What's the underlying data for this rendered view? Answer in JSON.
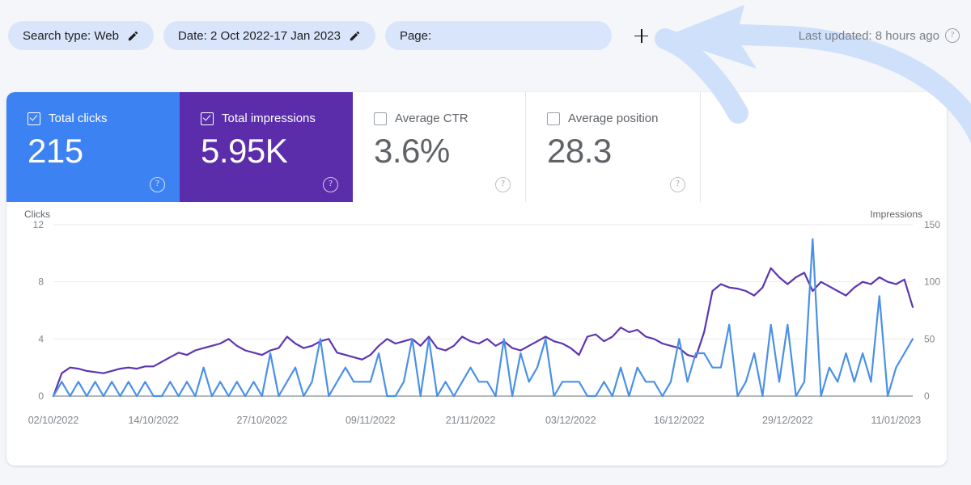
{
  "filters": {
    "search_type": {
      "label": "Search type: Web",
      "icon": "pencil-icon"
    },
    "date": {
      "label": "Date: 2 Oct 2022-17 Jan 2023",
      "icon": "pencil-icon"
    },
    "page": {
      "label": "Page:",
      "placeholder": ""
    },
    "add_filter": {
      "icon": "plus-icon"
    }
  },
  "status": {
    "last_updated": "Last updated: 8 hours ago",
    "help_icon": "question-circle-icon"
  },
  "metrics": [
    {
      "name": "Total clicks",
      "value": "215",
      "checked": true,
      "color": "#3d82f2",
      "help": "?"
    },
    {
      "name": "Total impressions",
      "value": "5.95K",
      "checked": true,
      "color": "#5b2dab",
      "help": "?"
    },
    {
      "name": "Average CTR",
      "value": "3.6%",
      "checked": false,
      "color": "#ffffff",
      "help": "?"
    },
    {
      "name": "Average position",
      "value": "28.3",
      "checked": false,
      "color": "#ffffff",
      "help": "?"
    }
  ],
  "annotation": {
    "type": "hand-drawn-arrow",
    "color": "#cfe0fb",
    "points_to": "add-filter-button"
  },
  "chart_data": {
    "type": "line",
    "title": "",
    "xlabel": "",
    "ylabel": "Clicks",
    "y2label": "Impressions",
    "ylim": [
      0,
      12
    ],
    "y2lim": [
      0,
      150
    ],
    "yticks": [
      0,
      4,
      8,
      12
    ],
    "y2ticks": [
      0,
      50,
      100,
      150
    ],
    "grid": true,
    "legend": "none",
    "xtick_labels": [
      "02/10/2022",
      "14/10/2022",
      "27/10/2022",
      "09/11/2022",
      "21/11/2022",
      "03/12/2022",
      "16/12/2022",
      "29/12/2022",
      "11/01/2023"
    ],
    "xtick_indices": [
      0,
      12,
      25,
      38,
      50,
      62,
      75,
      88,
      101
    ],
    "series": [
      {
        "name": "Total clicks",
        "color": "#4a90e8",
        "axis": "left",
        "values": [
          0,
          1,
          0,
          1,
          0,
          1,
          0,
          1,
          0,
          1,
          0,
          1,
          0,
          0,
          1,
          0,
          1,
          0,
          2,
          0,
          1,
          0,
          1,
          0,
          1,
          0,
          3,
          0,
          1,
          2,
          0,
          1,
          4,
          0,
          1,
          2,
          1,
          1,
          1,
          3,
          0,
          0,
          1,
          4,
          0,
          4,
          0,
          1,
          0,
          1,
          2,
          1,
          1,
          0,
          4,
          0,
          3,
          1,
          2,
          4,
          0,
          1,
          1,
          1,
          0,
          0,
          1,
          0,
          2,
          0,
          2,
          1,
          1,
          0,
          1,
          4,
          1,
          3,
          3,
          2,
          2,
          5,
          0,
          1,
          3,
          0,
          5,
          1,
          5,
          0,
          1,
          11,
          0,
          2,
          1,
          3,
          1,
          3,
          1,
          7,
          0,
          2,
          3,
          4
        ]
      },
      {
        "name": "Total impressions",
        "color": "#5e35b1",
        "axis": "right",
        "values": [
          0,
          20,
          25,
          24,
          22,
          21,
          20,
          22,
          24,
          25,
          24,
          26,
          26,
          30,
          34,
          38,
          36,
          40,
          42,
          44,
          46,
          50,
          44,
          40,
          38,
          36,
          40,
          42,
          52,
          46,
          42,
          44,
          48,
          50,
          38,
          36,
          34,
          32,
          36,
          44,
          50,
          46,
          48,
          50,
          44,
          52,
          42,
          40,
          44,
          52,
          48,
          46,
          50,
          44,
          48,
          42,
          40,
          44,
          48,
          52,
          48,
          46,
          42,
          36,
          52,
          54,
          48,
          52,
          60,
          56,
          58,
          52,
          50,
          46,
          44,
          42,
          36,
          34,
          56,
          92,
          98,
          95,
          94,
          92,
          88,
          95,
          112,
          104,
          98,
          104,
          108,
          92,
          100,
          96,
          92,
          88,
          95,
          100,
          98,
          104,
          100,
          98,
          102,
          78
        ]
      }
    ]
  }
}
